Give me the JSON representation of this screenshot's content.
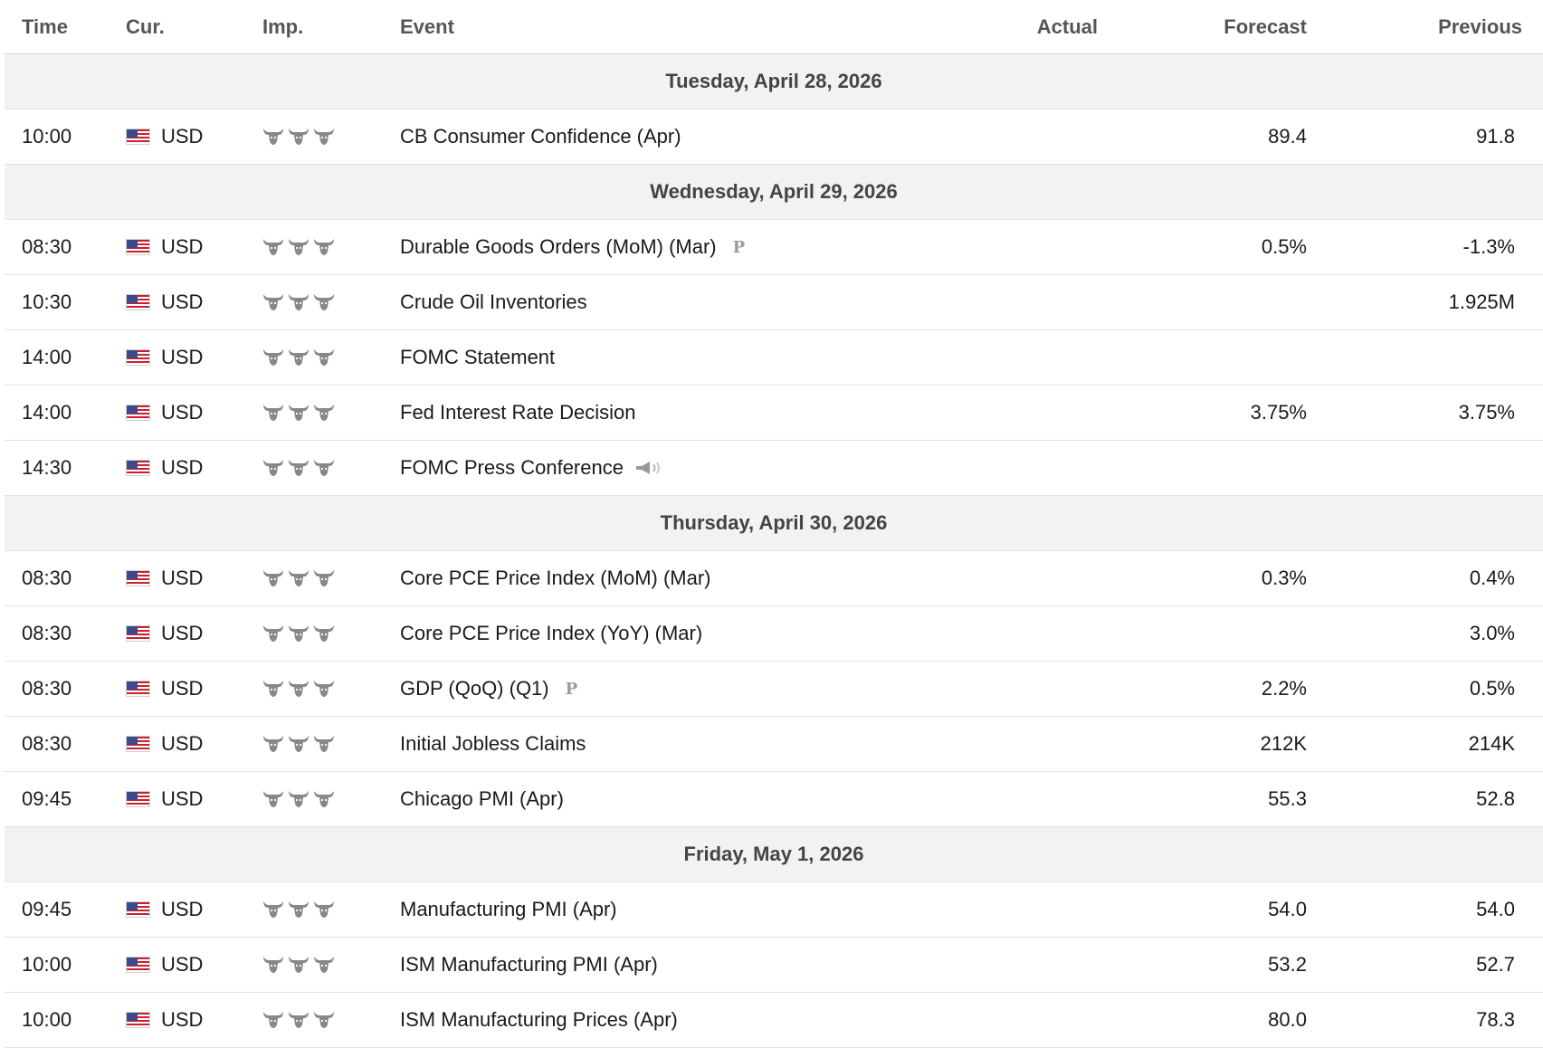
{
  "columns": {
    "time": "Time",
    "currency": "Cur.",
    "importance": "Imp.",
    "event": "Event",
    "actual": "Actual",
    "forecast": "Forecast",
    "previous": "Previous"
  },
  "days": [
    {
      "label": "Tuesday, April 28, 2026",
      "events": [
        {
          "time": "10:00",
          "currency": "USD",
          "importance": 3,
          "event": "CB Consumer Confidence (Apr)",
          "badge": "",
          "actual": "",
          "forecast": "89.4",
          "previous": "91.8"
        }
      ]
    },
    {
      "label": "Wednesday, April 29, 2026",
      "events": [
        {
          "time": "08:30",
          "currency": "USD",
          "importance": 3,
          "event": "Durable Goods Orders (MoM) (Mar)",
          "badge": "P",
          "actual": "",
          "forecast": "0.5%",
          "previous": "-1.3%"
        },
        {
          "time": "10:30",
          "currency": "USD",
          "importance": 3,
          "event": "Crude Oil Inventories",
          "badge": "",
          "actual": "",
          "forecast": "",
          "previous": "1.925M"
        },
        {
          "time": "14:00",
          "currency": "USD",
          "importance": 3,
          "event": "FOMC Statement",
          "badge": "",
          "actual": "",
          "forecast": "",
          "previous": ""
        },
        {
          "time": "14:00",
          "currency": "USD",
          "importance": 3,
          "event": "Fed Interest Rate Decision",
          "badge": "",
          "actual": "",
          "forecast": "3.75%",
          "previous": "3.75%"
        },
        {
          "time": "14:30",
          "currency": "USD",
          "importance": 3,
          "event": "FOMC Press Conference",
          "badge": "speech",
          "actual": "",
          "forecast": "",
          "previous": ""
        }
      ]
    },
    {
      "label": "Thursday, April 30, 2026",
      "events": [
        {
          "time": "08:30",
          "currency": "USD",
          "importance": 3,
          "event": "Core PCE Price Index (MoM) (Mar)",
          "badge": "",
          "actual": "",
          "forecast": "0.3%",
          "previous": "0.4%"
        },
        {
          "time": "08:30",
          "currency": "USD",
          "importance": 3,
          "event": "Core PCE Price Index (YoY) (Mar)",
          "badge": "",
          "actual": "",
          "forecast": "",
          "previous": "3.0%"
        },
        {
          "time": "08:30",
          "currency": "USD",
          "importance": 3,
          "event": "GDP (QoQ) (Q1)",
          "badge": "P",
          "actual": "",
          "forecast": "2.2%",
          "previous": "0.5%"
        },
        {
          "time": "08:30",
          "currency": "USD",
          "importance": 3,
          "event": "Initial Jobless Claims",
          "badge": "",
          "actual": "",
          "forecast": "212K",
          "previous": "214K"
        },
        {
          "time": "09:45",
          "currency": "USD",
          "importance": 3,
          "event": "Chicago PMI (Apr)",
          "badge": "",
          "actual": "",
          "forecast": "55.3",
          "previous": "52.8"
        }
      ]
    },
    {
      "label": "Friday, May 1, 2026",
      "events": [
        {
          "time": "09:45",
          "currency": "USD",
          "importance": 3,
          "event": "Manufacturing PMI (Apr)",
          "badge": "",
          "actual": "",
          "forecast": "54.0",
          "previous": "54.0"
        },
        {
          "time": "10:00",
          "currency": "USD",
          "importance": 3,
          "event": "ISM Manufacturing PMI (Apr)",
          "badge": "",
          "actual": "",
          "forecast": "53.2",
          "previous": "52.7"
        },
        {
          "time": "10:00",
          "currency": "USD",
          "importance": 3,
          "event": "ISM Manufacturing Prices (Apr)",
          "badge": "",
          "actual": "",
          "forecast": "80.0",
          "previous": "78.3"
        }
      ]
    }
  ],
  "icons": {
    "flag": "us-flag-icon",
    "importance": "bull-icon",
    "preliminary": "preliminary-icon",
    "speech": "speech-icon"
  },
  "colors": {
    "day_row_bg": "#f2f2f2",
    "header_text": "#555555",
    "bull_icon": "#888888",
    "flag_red": "#c8202e",
    "flag_blue": "#3c4a8c"
  }
}
